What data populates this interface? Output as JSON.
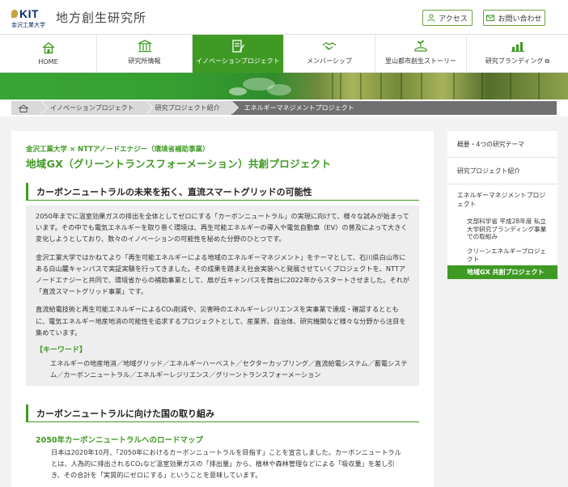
{
  "header": {
    "logo_text": "KIT",
    "logo_sub": "金沢工業大学",
    "site_title": "地方創生研究所",
    "access_label": "アクセス",
    "contact_label": "お問い合わせ"
  },
  "nav": {
    "items": [
      {
        "label": "HOME",
        "icon": "home-icon"
      },
      {
        "label": "研究所情報",
        "icon": "building-icon"
      },
      {
        "label": "イノベーションプロジェクト",
        "icon": "document-edit-icon",
        "active": true
      },
      {
        "label": "メンバーシップ",
        "icon": "handshake-icon"
      },
      {
        "label": "里山都市創生ストーリー",
        "icon": "sprout-hand-icon"
      },
      {
        "label": "研究ブランディング",
        "icon": "chart-icon",
        "external": true
      }
    ]
  },
  "breadcrumb": {
    "items": [
      "イノベーションプロジェクト",
      "研究プロジェクト紹介"
    ],
    "current": "エネルギーマネジメントプロジェクト"
  },
  "main": {
    "eyebrow": "金沢工業大学 × NTTアノードエナジー（環境省補助事業）",
    "title": "地域GX（グリーントランスフォーメーション）共創プロジェクト",
    "section1": {
      "heading": "カーボンニュートラルの未来を拓く、直流スマートグリッドの可能性",
      "paragraphs": [
        "2050年までに温室効果ガスの排出を全体としてゼロにする「カーボンニュートラル」の実現に向けて、様々な試みが始まっています。その中でも電気エネルギーを取り巻く環境は、再生可能エネルギーの導入や電気自動車（EV）の普及によって大きく変化しようとしており、数々のイノベーションの可能性を秘めた分野のひとつです。",
        "金沢工業大学ではかねてより「再生可能エネルギーによる地域のエネルギーマネジメント」をテーマとして、石川県白山市にある白山麓キャンパスで実証実験を行ってきました。その成果を踏まえ社会実装へと発展させていくプロジェクトを、NTTアノードエナジーと共同で、環境省からの補助事業として、扇が丘キャンパスを舞台に2022年からスタートさせました。それが「直流スマートグリッド事業」です。",
        "直流給電技術と再生可能エネルギーによるCO₂削減や、災害時のエネルギーレジリエンスを実事業で達成・確認するとともに、電気エネルギー地産地消の可能性を追求するプロジェクトとして、産業界、自治体、研究機関など様々な分野から注目を集めています。"
      ],
      "keyword_title": "【キーワード】",
      "keywords": "エネルギーの地産地消／地域グリッド／エネルギーハーベスト／セクターカップリング／直流給電システム／蓄電システム／カーボンニュートラル／エネルギーレジリエンス／グリーントランスフォーメーション"
    },
    "section2": {
      "heading": "カーボンニュートラルに向けた国の取り組み",
      "subheading": "2050年カーボンニュートラルへのロードマップ",
      "body": "日本は2020年10月、「2050年におけるカーボンニュートラルを目指す」ことを宣言しました。カーボンニュートラルとは、人為的に排出されるCO₂など温室効果ガスの「排出量」から、植林や森林管理などによる「吸収量」を差し引き、その合計を「実質的にゼロにする」ということを意味しています。"
    }
  },
  "sidebar": {
    "items": [
      "概要・4つの研究テーマ",
      "研究プロジェクト紹介",
      "エネルギーマネジメントプロジェクト"
    ],
    "subitems": [
      "文部科学省 平成28年度 私立大学研究ブランディング事業での取組み",
      "クリーンエネルギープロジェクト",
      "地域GX 共創プロジェクト"
    ]
  },
  "colors": {
    "accent": "#3f9a24",
    "breadcrumb_current": "#707070",
    "page_background": "#f2f2f2"
  }
}
